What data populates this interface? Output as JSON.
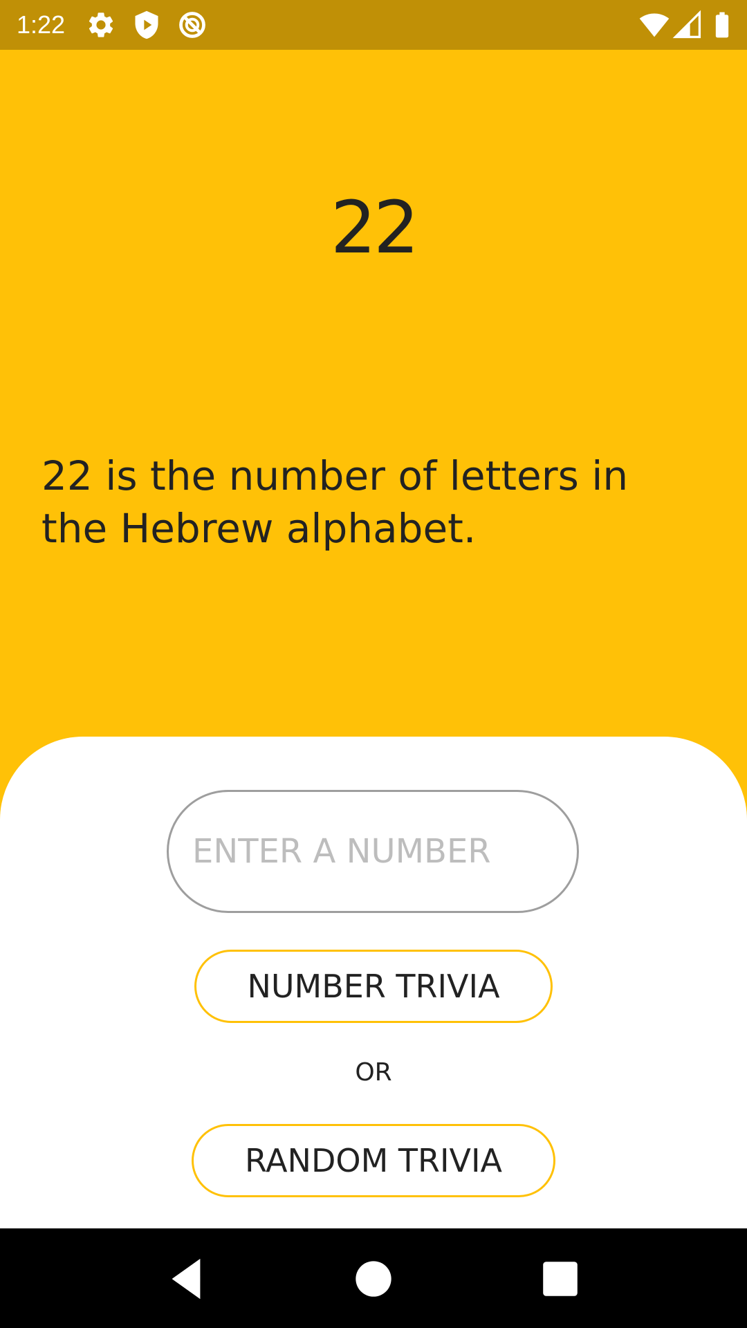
{
  "status_bar": {
    "time": "1:22",
    "left_icons": [
      "gear-icon",
      "shield-play-icon",
      "no-sync-icon"
    ],
    "right_icons": [
      "wifi-icon",
      "signal-icon",
      "battery-icon"
    ],
    "background": "#C09006"
  },
  "trivia": {
    "number": "22",
    "fact": "22 is the number of letters in the Hebrew alphabet.",
    "background": "#FFC107"
  },
  "controls": {
    "input": {
      "placeholder": "ENTER A NUMBER",
      "value": ""
    },
    "number_trivia_label": "NUMBER TRIVIA",
    "or_label": "OR",
    "random_trivia_label": "RANDOM TRIVIA",
    "accent_color": "#FFC107"
  },
  "nav_bar": {
    "buttons": [
      "back-icon",
      "home-icon",
      "recents-icon"
    ]
  }
}
